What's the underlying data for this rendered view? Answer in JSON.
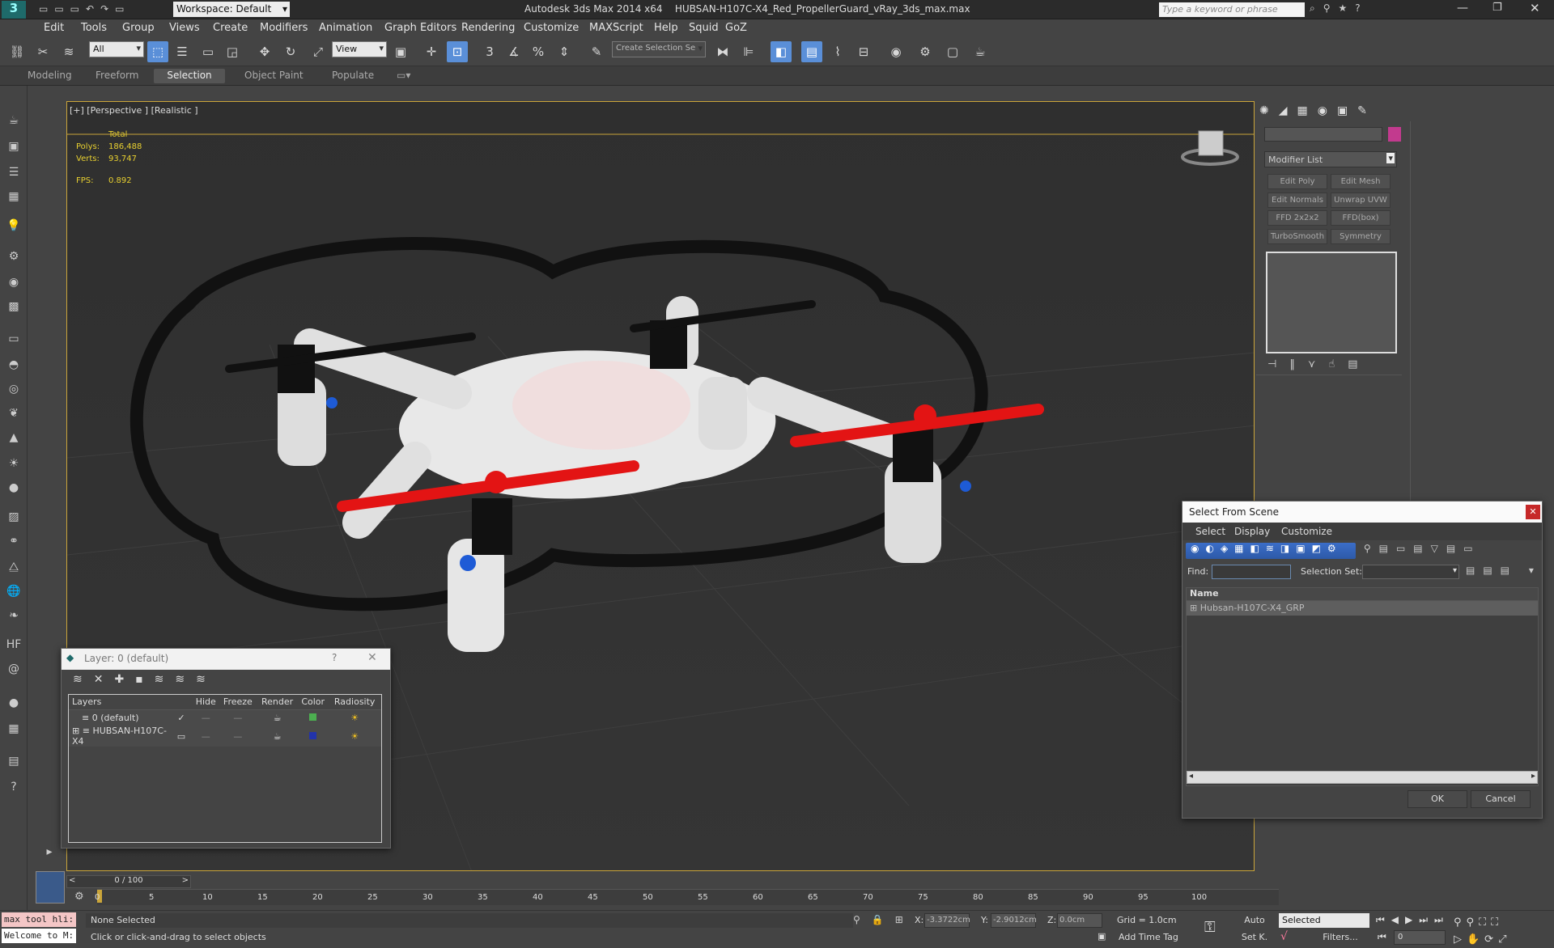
{
  "title": {
    "workspace": "Workspace: Default",
    "app": "Autodesk 3ds Max  2014 x64",
    "file": "HUBSAN-H107C-X4_Red_PropellerGuard_vRay_3ds_max.max",
    "search_placeholder": "Type a keyword or phrase"
  },
  "menu": [
    "Edit",
    "Tools",
    "Group",
    "Views",
    "Create",
    "Modifiers",
    "Animation",
    "Graph Editors",
    "Rendering",
    "Customize",
    "MAXScript",
    "Help",
    "Squid",
    "GoZ"
  ],
  "toolbar": {
    "filter": "All",
    "refcoord": "View",
    "selset": "Create Selection Se"
  },
  "ribbon": [
    "Modeling",
    "Freeform",
    "Selection",
    "Object Paint",
    "Populate"
  ],
  "viewport": {
    "label": "[+] [Perspective ] [Realistic ]",
    "stats_header": "Total",
    "polys_label": "Polys:",
    "polys": "186,488",
    "verts_label": "Verts:",
    "verts": "93,747",
    "fps_label": "FPS:",
    "fps": "0.892"
  },
  "cmd": {
    "modifier_list": "Modifier List",
    "buttons": [
      "Edit Poly",
      "Edit Mesh",
      "Edit Normals",
      "Unwrap UVW",
      "FFD 2x2x2",
      "FFD(box)",
      "TurboSmooth",
      "Symmetry"
    ]
  },
  "layer_dialog": {
    "title": "Layer: 0 (default)",
    "help": "?",
    "cols": [
      "Layers",
      "Hide",
      "Freeze",
      "Render",
      "Color",
      "Radiosity"
    ],
    "rows": [
      {
        "name": "0 (default)",
        "color": "#4caf50"
      },
      {
        "name": "HUBSAN-H107C-X4",
        "color": "#2233aa"
      }
    ]
  },
  "select_dialog": {
    "title": "Select From Scene",
    "menu": [
      "Select",
      "Display",
      "Customize"
    ],
    "find_label": "Find:",
    "selset_label": "Selection Set:",
    "col_name": "Name",
    "item": "Hubsan-H107C-X4_GRP",
    "ok": "OK",
    "cancel": "Cancel"
  },
  "timeline": {
    "frame": "0 / 100",
    "ticks": [
      "0",
      "5",
      "10",
      "15",
      "20",
      "25",
      "30",
      "35",
      "40",
      "45",
      "50",
      "55",
      "60",
      "65",
      "70",
      "75",
      "80",
      "85",
      "90",
      "95",
      "100"
    ]
  },
  "status": {
    "script1": "max tool hli:",
    "script2": "Welcome to M:",
    "selected": "None Selected",
    "prompt": "Click or click-and-drag to select objects",
    "x_label": "X:",
    "x": "-3.3722cm",
    "y_label": "Y:",
    "y": "-2.9012cm",
    "z_label": "Z:",
    "z": "0.0cm",
    "grid": "Grid = 1.0cm",
    "add_tag": "Add Time Tag",
    "auto": "Auto",
    "setk": "Set K.",
    "selmode": "Selected",
    "filters": "Filters...",
    "frame_val": "0"
  }
}
